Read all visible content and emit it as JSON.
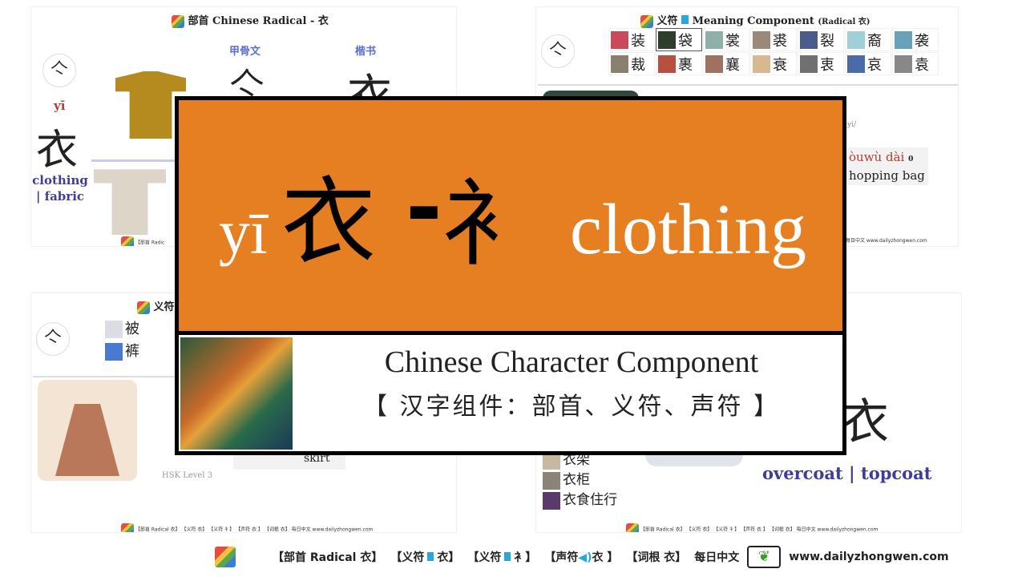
{
  "colors": {
    "banner": "#E57F22",
    "pinyin_red": "#c0392b",
    "meaning_blue": "#3e3e9a",
    "label_blue": "#5b6fd6"
  },
  "banner": {
    "pinyin": "yī",
    "character": "衣",
    "dash": "-",
    "variant": "衤",
    "meaning": "clothing",
    "subtitle": "Chinese Character Component",
    "subtitle_cn": "【 汉字组件：部首、义符、声符 】"
  },
  "card_radical": {
    "title": "部首 Chinese Radical - 衣",
    "oracle_label": "甲骨文",
    "oracle_char": "亽",
    "regular_label": "楷书",
    "regular_char": "衣",
    "pinyin": "yī",
    "character": "衣",
    "meaning": "clothing | fabric",
    "seal": "亽\nリ",
    "footer": "【部首 Radic"
  },
  "card_meaning": {
    "title": "义符",
    "title_en": "Meaning Component",
    "title_note": "(Radical 衣)",
    "chars": [
      "装",
      "袋",
      "裳",
      "裘",
      "裂",
      "裔",
      "袭",
      "裁",
      "裹",
      "襄",
      "衰",
      "衷",
      "哀",
      "袁"
    ],
    "partial_text": "yi/",
    "word_pinyin": "òuwù dài",
    "word_badge": "0",
    "word_meaning": "hopping bag",
    "footer": "每日中文 www.dailyzhongwen.com"
  },
  "card_meaning2": {
    "title": "义符",
    "chars": [
      "被",
      "裤"
    ],
    "hsk": "HSK Level 3",
    "word_meaning": "skirt",
    "footer": "【部首 Radical 衣】 【义符 衣】 【义符 衤】 【声符 衣 】 【词根 衣】 每日中文 www.dailyzhongwen.com"
  },
  "card_root": {
    "char": "衣",
    "words": [
      "衣架",
      "衣柜",
      "衣食住行"
    ],
    "meaning": "overcoat | topcoat",
    "footer": "【部首 Radical 衣】 【义符 衣】 【义符 衤】 【声符 衣 】 【词根 衣】 每日中文 www.dailyzhongwen.com"
  },
  "footer": {
    "links": [
      "【部首 Radical 衣】",
      "【义符",
      "衣】",
      "【义符",
      "衤】",
      "【声符",
      "衣 】",
      "【词根 衣】"
    ],
    "brand": "每日中文",
    "url": "www.dailyzhongwen.com"
  }
}
